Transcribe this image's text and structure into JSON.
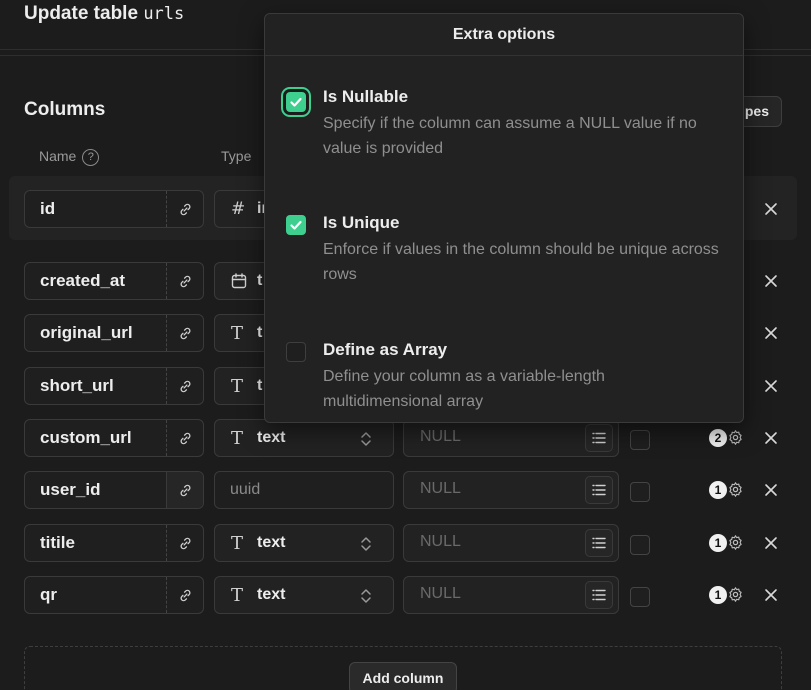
{
  "header": {
    "title_prefix": "Update table",
    "table_name": "urls"
  },
  "columns_section": {
    "title": "Columns",
    "types_button_partial": "pes",
    "headers": {
      "name": "Name",
      "type": "Type",
      "help": "?"
    },
    "add_column_label": "Add column"
  },
  "rows": [
    {
      "name": "id",
      "type_icon": "#",
      "type": "in",
      "default": "",
      "badge": ""
    },
    {
      "name": "created_at",
      "type_icon": "calendar",
      "type": "t",
      "default": "",
      "badge": ""
    },
    {
      "name": "original_url",
      "type_icon": "T",
      "type": "t",
      "default": "",
      "badge": ""
    },
    {
      "name": "short_url",
      "type_icon": "T",
      "type": "t",
      "default": "",
      "badge": ""
    },
    {
      "name": "custom_url",
      "type_icon": "T",
      "type": "text",
      "default": "NULL",
      "badge": "2"
    },
    {
      "name": "user_id",
      "type_icon": "",
      "type": "uuid",
      "default": "NULL",
      "badge": "1"
    },
    {
      "name": "titile",
      "type_icon": "T",
      "type": "text",
      "default": "NULL",
      "badge": "1"
    },
    {
      "name": "qr",
      "type_icon": "T",
      "type": "text",
      "default": "NULL",
      "badge": "1"
    }
  ],
  "popover": {
    "title": "Extra options",
    "options": [
      {
        "label": "Is Nullable",
        "description": "Specify if the column can assume a NULL value if no value is provided",
        "checked": true
      },
      {
        "label": "Is Unique",
        "description": "Enforce if values in the column should be unique across rows",
        "checked": true
      },
      {
        "label": "Define as Array",
        "description": "Define your column as a variable-length multidimensional array",
        "checked": false
      }
    ]
  },
  "colors": {
    "accent": "#3ecf8e",
    "background": "#1c1c1c"
  }
}
